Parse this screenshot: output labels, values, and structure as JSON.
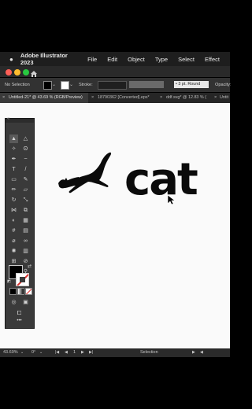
{
  "menubar": {
    "apple": "",
    "app_name": "Adobe Illustrator 2023",
    "items": [
      "File",
      "Edit",
      "Object",
      "Type",
      "Select",
      "Effect"
    ]
  },
  "control_bar": {
    "selection_label": "No Selection",
    "stroke_label": "Stroke:",
    "brush_label": "3 pt. Round",
    "opacity_label": "Opacity:"
  },
  "tabs": [
    {
      "label": "Untitled-21* @ 43.69 % (RGB/Preview)",
      "active": true
    },
    {
      "label": "18790362 [Converted].eps*"
    },
    {
      "label": "ddf.svg* @ 12.83 % ("
    },
    {
      "label": "Untit"
    }
  ],
  "canvas": {
    "logo_text": "cat"
  },
  "status": {
    "zoom": "43.69%",
    "angle": "0°",
    "artboard": "1",
    "tool": "Selection"
  },
  "colors": {
    "accent_red": "#d9302c",
    "panel": "#323232",
    "canvas": "#fafafa"
  }
}
